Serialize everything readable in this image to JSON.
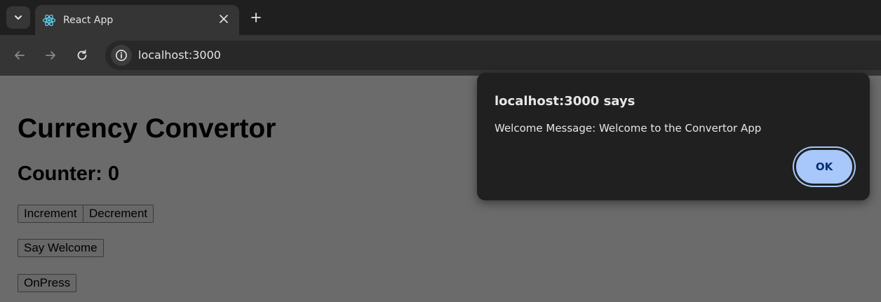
{
  "browser": {
    "tab": {
      "title": "React App",
      "favicon": "react-logo-icon"
    },
    "url": "localhost:3000"
  },
  "page": {
    "heading": "Currency Convertor",
    "counter": "Counter: 0",
    "buttons": {
      "increment": "Increment",
      "decrement": "Decrement",
      "say_welcome": "Say Welcome",
      "onpress": "OnPress"
    }
  },
  "dialog": {
    "title": "localhost:3000 says",
    "message": "Welcome Message: Welcome to the Convertor App",
    "ok_label": "OK"
  },
  "colors": {
    "chrome_dark": "#1f1f1f",
    "toolbar": "#353535",
    "page_dimmed": "#6b6b6b",
    "dialog_bg": "#202020",
    "ok_button": "#a8c7fa"
  }
}
